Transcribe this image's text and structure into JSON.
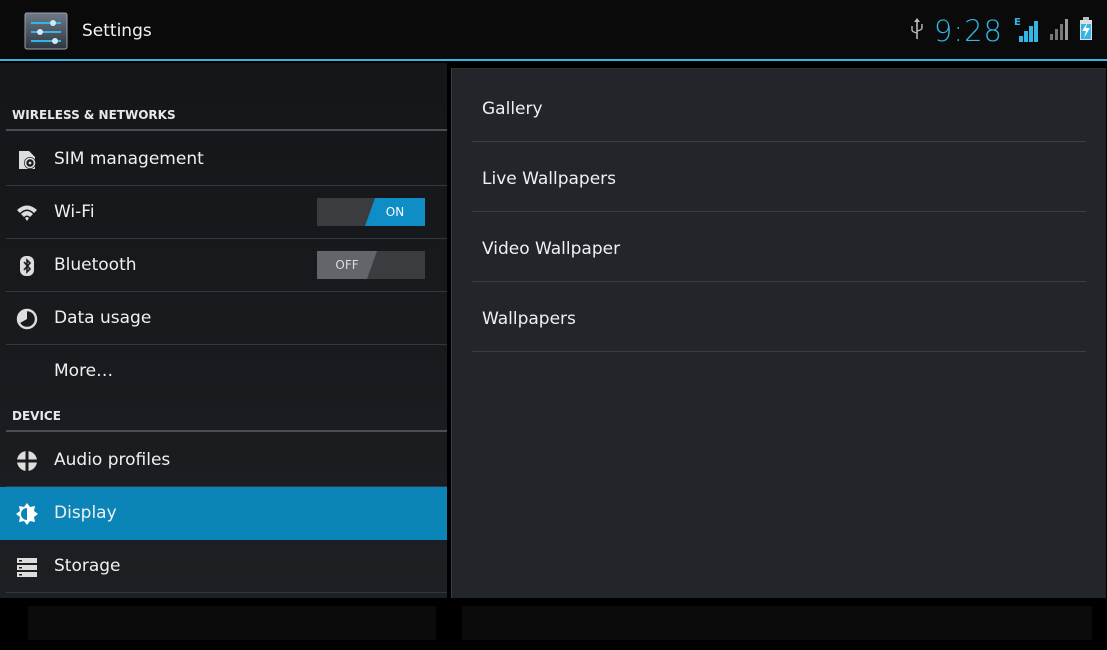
{
  "app": {
    "title": "Settings",
    "icon": "settings-sliders-icon"
  },
  "status_bar": {
    "time": "9:28",
    "network_letter": "E",
    "icons": [
      "usb-icon",
      "signal-e-icon",
      "signal-icon",
      "battery-charging-icon"
    ],
    "accent": "#33b5e5"
  },
  "sidebar": {
    "headers": [
      "WIRELESS & NETWORKS",
      "DEVICE"
    ],
    "items": [
      {
        "label": "SIM management",
        "icon": "sim-management-icon"
      },
      {
        "label": "Wi-Fi",
        "icon": "wifi-icon",
        "toggle": "ON"
      },
      {
        "label": "Bluetooth",
        "icon": "bluetooth-icon",
        "toggle": "OFF"
      },
      {
        "label": "Data usage",
        "icon": "data-usage-icon"
      },
      {
        "label": "More…",
        "icon": ""
      },
      {
        "label": "Audio profiles",
        "icon": "audio-profiles-icon"
      },
      {
        "label": "Display",
        "icon": "display-icon",
        "selected": true
      },
      {
        "label": "Storage",
        "icon": "storage-icon"
      }
    ],
    "selected_color": "#0b85b8"
  },
  "detail": {
    "items": [
      {
        "label": "Gallery"
      },
      {
        "label": "Live Wallpapers"
      },
      {
        "label": "Video Wallpaper"
      },
      {
        "label": "Wallpapers"
      }
    ]
  }
}
